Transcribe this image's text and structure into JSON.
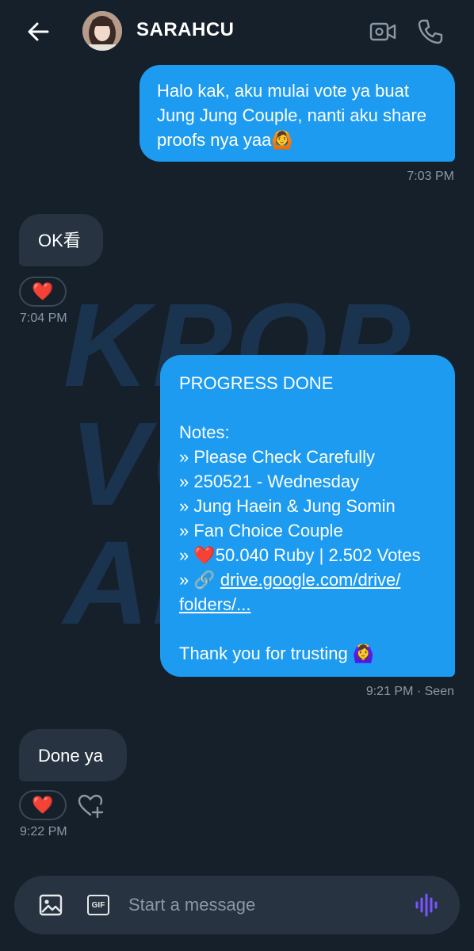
{
  "header": {
    "contact_name": "SARAHCU",
    "icons": [
      "back-arrow-icon",
      "video-call-icon",
      "phone-call-icon"
    ]
  },
  "watermark": {
    "lines": [
      "KPOP",
      "VOTE",
      "AREA"
    ]
  },
  "messages": [
    {
      "direction": "sent",
      "text": "Halo kak, aku mulai vote ya buat\nJung Jung Couple, nanti aku share\nproofs nya yaa🙆",
      "time": "7:03 PM"
    },
    {
      "direction": "received",
      "text": "OK看",
      "reaction": "❤️",
      "time": "7:04 PM"
    },
    {
      "direction": "sent",
      "lines": {
        "title": "PROGRESS DONE",
        "notes": "Notes:",
        "l1": "» Please Check Carefully",
        "l2": "» 250521 - Wednesday",
        "l3": "» Jung Haein & Jung Somin",
        "l4": "» Fan Choice Couple",
        "l5": "» ❤️50.040 Ruby | 2.502 Votes",
        "link_prefix": "» 🔗",
        "link_text_1": "drive.google.com/drive/",
        "link_text_2": "folders/...",
        "closing": "Thank you for trusting 🙆‍♀️"
      },
      "time": "9:21 PM · Seen"
    },
    {
      "direction": "received",
      "text": "Done ya",
      "reaction": "❤️",
      "time": "9:22 PM"
    }
  ],
  "composer": {
    "placeholder": "Start a message",
    "gif_label": "GIF"
  },
  "colors": {
    "background": "#15202b",
    "sent_bubble": "#1d9bf0",
    "received_bubble": "#273340",
    "timestamp": "#8b98a5",
    "voice_accent": "#7856ff"
  }
}
